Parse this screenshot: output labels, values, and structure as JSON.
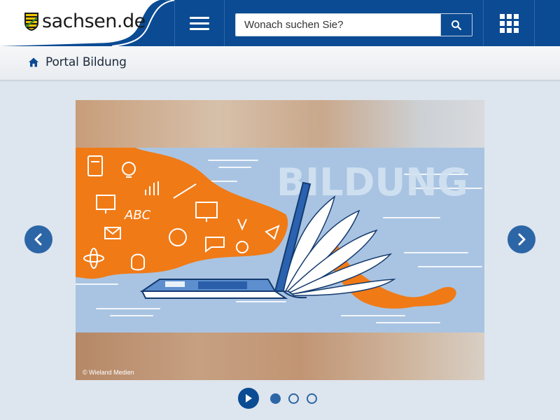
{
  "header": {
    "logo_text": "sachsen.de",
    "search_placeholder": "Wonach suchen Sie?",
    "brand_color": "#0b4b93"
  },
  "icons": {
    "menu": "hamburger-icon",
    "search": "magnifier-icon",
    "apps": "grid-icon",
    "home": "home-icon"
  },
  "breadcrumb": {
    "label": "Portal Bildung"
  },
  "slider": {
    "heading": "BILDUNG",
    "credit": "© Wieland Medien",
    "slide_count": 3,
    "active_slide": 1
  }
}
